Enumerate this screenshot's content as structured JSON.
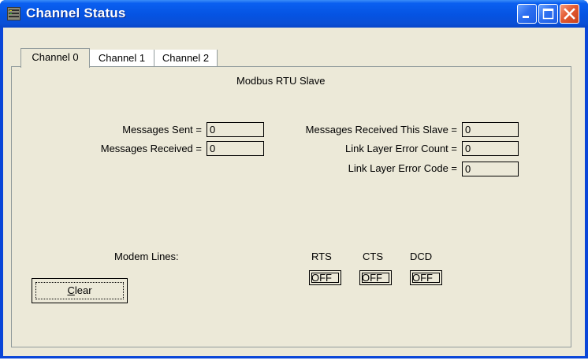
{
  "window": {
    "title": "Channel Status"
  },
  "tabs": [
    {
      "label": "Channel 0",
      "active": true
    },
    {
      "label": "Channel 1",
      "active": false
    },
    {
      "label": "Channel 2",
      "active": false
    }
  ],
  "panel": {
    "heading": "Modbus RTU Slave",
    "messages_sent_label": "Messages Sent =",
    "messages_sent_value": "0",
    "messages_received_label": "Messages Received =",
    "messages_received_value": "0",
    "received_this_slave_label": "Messages Received This Slave =",
    "received_this_slave_value": "0",
    "link_error_count_label": "Link Layer Error Count =",
    "link_error_count_value": "0",
    "link_error_code_label": "Link Layer Error Code =",
    "link_error_code_value": "0",
    "modem_lines_label": "Modem Lines:",
    "rts_label": "RTS",
    "rts_value": "OFF",
    "cts_label": "CTS",
    "cts_value": "OFF",
    "dcd_label": "DCD",
    "dcd_value": "OFF",
    "clear_button": {
      "mnemonic": "C",
      "rest": "lear"
    }
  },
  "icons": {
    "app": "app-icon",
    "minimize": "minimize-icon",
    "maximize": "maximize-icon",
    "close": "close-icon"
  },
  "colors": {
    "titlebar": "#0553e2",
    "client": "#ece9d8",
    "close": "#e35a32"
  }
}
